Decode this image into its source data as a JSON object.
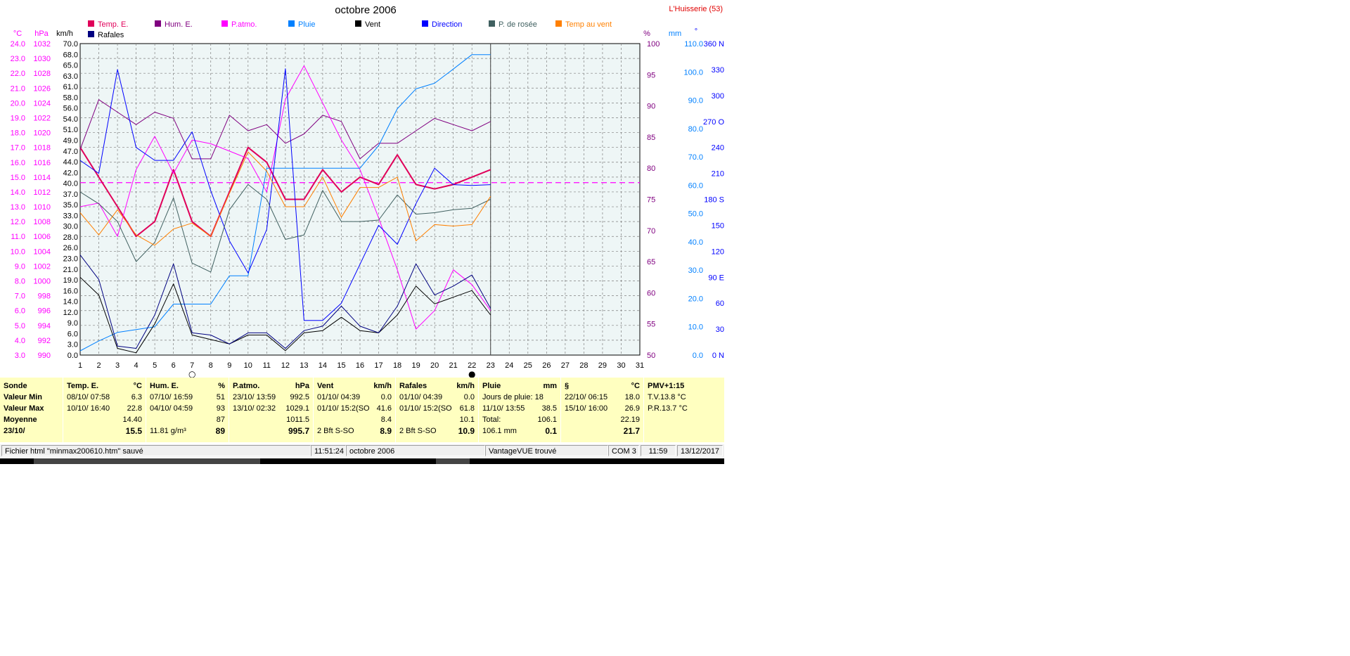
{
  "title": "octobre 2006",
  "station": "L'Huisserie (53)",
  "colors": {
    "temp": "#e0005a",
    "hum": "#800080",
    "patmo": "#ff00ff",
    "pluie": "#0080ff",
    "vent": "#000000",
    "direction": "#0000ff",
    "rosee": "#406060",
    "tempvent": "#ff8000",
    "rafales": "#000080",
    "grid": "#808080",
    "bg": "#eef6f6"
  },
  "legend": [
    {
      "label": "Temp. E.",
      "color": "#e0005a",
      "text_color": "#e0005a"
    },
    {
      "label": "Hum. E.",
      "color": "#800080",
      "text_color": "#800080"
    },
    {
      "label": "P.atmo.",
      "color": "#ff00ff",
      "text_color": "#ff00ff"
    },
    {
      "label": "Pluie",
      "color": "#0080ff",
      "text_color": "#0080ff"
    },
    {
      "label": "Vent",
      "color": "#000000",
      "text_color": "#000000"
    },
    {
      "label": "Direction",
      "color": "#0000ff",
      "text_color": "#0000ff"
    },
    {
      "label": "P. de rosée",
      "color": "#406060",
      "text_color": "#406060"
    },
    {
      "label": "Temp au vent",
      "color": "#ff8000",
      "text_color": "#ff8000"
    },
    {
      "label": "Rafales",
      "color": "#000080",
      "text_color": "#000000"
    }
  ],
  "chart_data": {
    "type": "line",
    "title": "octobre 2006",
    "x": [
      1,
      2,
      3,
      4,
      5,
      6,
      7,
      8,
      9,
      10,
      11,
      12,
      13,
      14,
      15,
      16,
      17,
      18,
      19,
      20,
      21,
      22,
      23
    ],
    "x_ticks": [
      "1",
      "2",
      "3",
      "4",
      "5",
      "6",
      "7",
      "8",
      "9",
      "10",
      "11",
      "12",
      "13",
      "14",
      "15",
      "16",
      "17",
      "18",
      "19",
      "20",
      "21",
      "22",
      "23",
      "24",
      "25",
      "26",
      "27",
      "28",
      "29",
      "30",
      "31"
    ],
    "xlim": [
      1,
      31
    ],
    "axes": {
      "temp": {
        "unit": "°C",
        "ylim": [
          3.0,
          24.0
        ],
        "ticks": [
          "3.0",
          "4.0",
          "5.0",
          "6.0",
          "7.0",
          "8.0",
          "9.0",
          "10.0",
          "11.0",
          "12.0",
          "13.0",
          "14.0",
          "15.0",
          "16.0",
          "17.0",
          "18.0",
          "19.0",
          "20.0",
          "21.0",
          "22.0",
          "23.0",
          "24.0"
        ]
      },
      "hpa": {
        "unit": "hPa",
        "ylim": [
          990,
          1032
        ],
        "ticks": [
          "990",
          "992",
          "994",
          "996",
          "998",
          "1000",
          "1002",
          "1004",
          "1006",
          "1008",
          "1010",
          "1012",
          "1014",
          "1016",
          "1018",
          "1020",
          "1022",
          "1024",
          "1026",
          "1028",
          "1030",
          "1032"
        ]
      },
      "kmh": {
        "unit": "km/h",
        "ylim": [
          0,
          70
        ],
        "ticks": [
          "0.0",
          "3.0",
          "6.0",
          "9.0",
          "12.0",
          "14.0",
          "16.0",
          "19.0",
          "21.0",
          "23.0",
          "26.0",
          "28.0",
          "30.0",
          "33.0",
          "35.0",
          "37.0",
          "40.0",
          "42.0",
          "44.0",
          "47.0",
          "49.0",
          "51.0",
          "54.0",
          "56.0",
          "58.0",
          "61.0",
          "63.0",
          "65.0",
          "68.0",
          "70.0"
        ]
      },
      "pct": {
        "unit": "%",
        "ylim": [
          50,
          100
        ],
        "ticks": [
          "50",
          "55",
          "60",
          "65",
          "70",
          "75",
          "80",
          "85",
          "90",
          "95",
          "100"
        ]
      },
      "mm": {
        "unit": "mm",
        "ylim": [
          0,
          110
        ],
        "ticks": [
          "0.0",
          "10.0",
          "20.0",
          "30.0",
          "40.0",
          "50.0",
          "60.0",
          "70.0",
          "80.0",
          "90.0",
          "100.0",
          "110.0"
        ]
      },
      "deg": {
        "unit": "°",
        "ylim": [
          0,
          360
        ],
        "ticks": [
          "0 N",
          "30",
          "60",
          "90 E",
          "120",
          "150",
          "180 S",
          "210",
          "240",
          "270 O",
          "300",
          "330",
          "360 N"
        ]
      }
    },
    "series": [
      {
        "name": "Temp. E.",
        "axis": "temp",
        "color": "#e0005a",
        "width": 2,
        "values": [
          17.0,
          15.0,
          13.0,
          11.0,
          12.0,
          15.5,
          12.0,
          11.0,
          14.0,
          17.0,
          16.0,
          13.5,
          13.5,
          15.5,
          14.0,
          15.0,
          14.5,
          16.5,
          14.5,
          14.2,
          14.5,
          15.0,
          15.5
        ]
      },
      {
        "name": "Hum. E.",
        "axis": "pct",
        "color": "#800080",
        "width": 1,
        "values": [
          83,
          91,
          89,
          87,
          89,
          88,
          81.5,
          81.5,
          88.5,
          86,
          87,
          84,
          85.5,
          88.5,
          87.5,
          81.5,
          84,
          84,
          86,
          88,
          87,
          86,
          87.5
        ]
      },
      {
        "name": "P.atmo.",
        "axis": "hpa",
        "color": "#ff00ff",
        "width": 1,
        "values": [
          1010,
          1010.5,
          1006,
          1015,
          1019.5,
          1014.5,
          1019,
          1018.5,
          1017.5,
          1016.5,
          1012,
          1024.5,
          1029,
          1024,
          1019,
          1015,
          1008.5,
          1001.5,
          993.5,
          996,
          1001.5,
          999.5,
          996
        ]
      },
      {
        "name": "Pluie",
        "axis": "mm",
        "color": "#0080ff",
        "width": 1,
        "values": [
          1.5,
          5,
          8,
          9,
          10,
          18,
          18,
          18,
          28,
          28,
          66,
          66,
          66,
          66,
          66,
          66,
          74,
          87,
          94,
          96,
          101,
          106.1,
          106.1
        ]
      },
      {
        "name": "Vent",
        "axis": "kmh",
        "color": "#000000",
        "width": 1,
        "values": [
          17.5,
          13.5,
          1.5,
          0.5,
          7,
          16,
          4.5,
          3.5,
          2.5,
          4.5,
          4.5,
          1,
          5,
          5.5,
          8.5,
          5.5,
          5,
          9,
          15.5,
          11.5,
          13,
          14.5,
          9
        ]
      },
      {
        "name": "Direction",
        "axis": "deg",
        "color": "#0000ff",
        "width": 1,
        "values": [
          225,
          210,
          330,
          240,
          225,
          225,
          258,
          190,
          132,
          95,
          145,
          331,
          40,
          40,
          60,
          105,
          150,
          128,
          175,
          216,
          197,
          196,
          197
        ]
      },
      {
        "name": "Rafales",
        "axis": "kmh",
        "color": "#000080",
        "width": 1,
        "values": [
          22.5,
          17,
          2,
          1.5,
          9,
          20.5,
          5,
          4.5,
          2.5,
          5,
          5,
          1.5,
          5.5,
          6.5,
          11,
          6.5,
          5,
          11,
          20.5,
          13.5,
          15.5,
          18,
          10.5
        ]
      },
      {
        "name": "P. de rosée",
        "axis": "temp",
        "color": "#406060",
        "width": 1,
        "values": [
          14.0,
          13.2,
          12.0,
          9.3,
          10.6,
          13.6,
          9.2,
          8.6,
          12.8,
          14.5,
          13.5,
          10.8,
          11.1,
          14.1,
          12.0,
          12.0,
          12.1,
          13.8,
          12.5,
          12.6,
          12.8,
          12.9,
          13.5
        ]
      },
      {
        "name": "Temp au vent",
        "axis": "temp",
        "color": "#ff8000",
        "width": 1,
        "values": [
          12.6,
          11.1,
          12.8,
          11.1,
          10.4,
          11.5,
          11.9,
          11.0,
          13.9,
          16.7,
          15.4,
          13.0,
          13.0,
          15.0,
          12.3,
          14.3,
          14.3,
          15.0,
          10.7,
          11.8,
          11.7,
          11.8,
          13.7
        ]
      }
    ],
    "reference_line": {
      "axis": "hpa",
      "value": 1013.25,
      "color": "#ff00ff",
      "style": "dashed"
    },
    "day_markers": [
      {
        "day": 7,
        "symbol": "○"
      },
      {
        "day": 22,
        "symbol": "●"
      }
    ],
    "cursor_day": 23
  },
  "stats": {
    "headers": [
      "Sonde",
      "Valeur Min",
      "Valeur Max",
      "Moyenne",
      "23/10/"
    ],
    "temp": {
      "title": "Temp. E.",
      "unit": "°C",
      "min_time": "08/10/  07:58",
      "min": "6.3",
      "max_time": "10/10/  16:40",
      "max": "22.8",
      "avg": "14.40",
      "cur": "15.5"
    },
    "hum": {
      "title": "Hum. E.",
      "unit": "%",
      "min_time": "07/10/  16:59",
      "min": "51",
      "max_time": "04/10/  04:59",
      "max": "93",
      "avg": "87",
      "cur_extra": "11.81 g/m³",
      "cur": "89"
    },
    "patmo": {
      "title": "P.atmo.",
      "unit": "hPa",
      "min_time": "23/10/  13:59",
      "min": "992.5",
      "max_time": "13/10/  02:32",
      "max": "1029.1",
      "avg": "1011.5",
      "cur": "995.7"
    },
    "vent": {
      "title": "Vent",
      "unit": "km/h",
      "min_time": "01/10/  04:39",
      "min": "0.0",
      "max_time": "01/10/  15:2(SO",
      "max": "41.6",
      "avg": "8.4",
      "cur_extra": "2 Bft  S-SO",
      "cur": "8.9"
    },
    "rafales": {
      "title": "Rafales",
      "unit": "km/h",
      "min_time": "01/10/  04:39",
      "min": "0.0",
      "max_time": "01/10/  15:2(SO",
      "max": "61.8",
      "avg": "10.1",
      "cur_extra": "2 Bft  S-SO",
      "cur": "10.9"
    },
    "pluie": {
      "title": "Pluie",
      "unit": "mm",
      "min_time": "Jours de pluie: 18",
      "min": "",
      "max_time": "11/10/  13:55",
      "max": "38.5",
      "avg_label": "Total:",
      "avg": "106.1",
      "cur_extra": "106.1 mm",
      "cur": "0.1"
    },
    "s": {
      "title": "§",
      "unit": "°C",
      "min_time": "22/10/  06:15",
      "min": "18.0",
      "max_time": "15/10/  16:00",
      "max": "26.9",
      "avg": "22.19",
      "cur": "21.7"
    },
    "pmv": {
      "title": "PMV+1:15",
      "line1": "T.V.13.8 °C",
      "line2": "P.R.13.7 °C"
    }
  },
  "status": {
    "file": "Fichier html  \"minmax200610.htm\"  sauvé",
    "time": "11:51:24",
    "month": "octobre 2006",
    "device": "VantageVUE trouvé",
    "port": "COM 3",
    "clock": "11:59",
    "date": "13/12/2017"
  }
}
